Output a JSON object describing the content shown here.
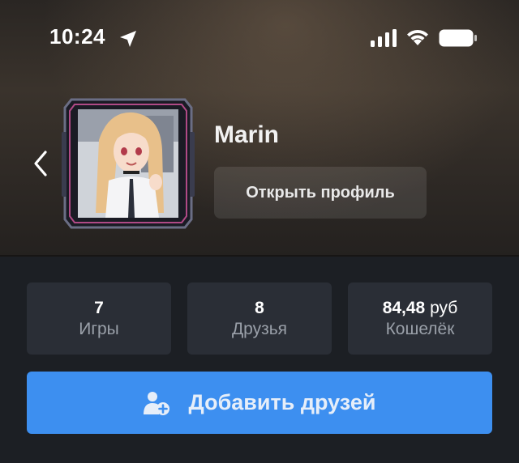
{
  "status_bar": {
    "time": "10:24",
    "location_icon": "location-arrow-icon",
    "signal_icon": "cellular-signal-icon",
    "wifi_icon": "wifi-icon",
    "battery_icon": "battery-icon"
  },
  "header": {
    "back_icon": "chevron-left-icon",
    "username": "Marin",
    "open_profile_label": "Открыть профиль"
  },
  "stats": [
    {
      "value": "7",
      "unit": "",
      "label": "Игры"
    },
    {
      "value": "8",
      "unit": "",
      "label": "Друзья"
    },
    {
      "value": "84,48",
      "unit": " руб",
      "label": "Кошелёк"
    }
  ],
  "actions": {
    "add_friends_label": "Добавить друзей",
    "add_friends_icon": "add-user-icon"
  },
  "colors": {
    "background": "#1c1f24",
    "card": "#2a2e36",
    "accent": "#3d8ff0",
    "muted_text": "#9aa0a9"
  }
}
